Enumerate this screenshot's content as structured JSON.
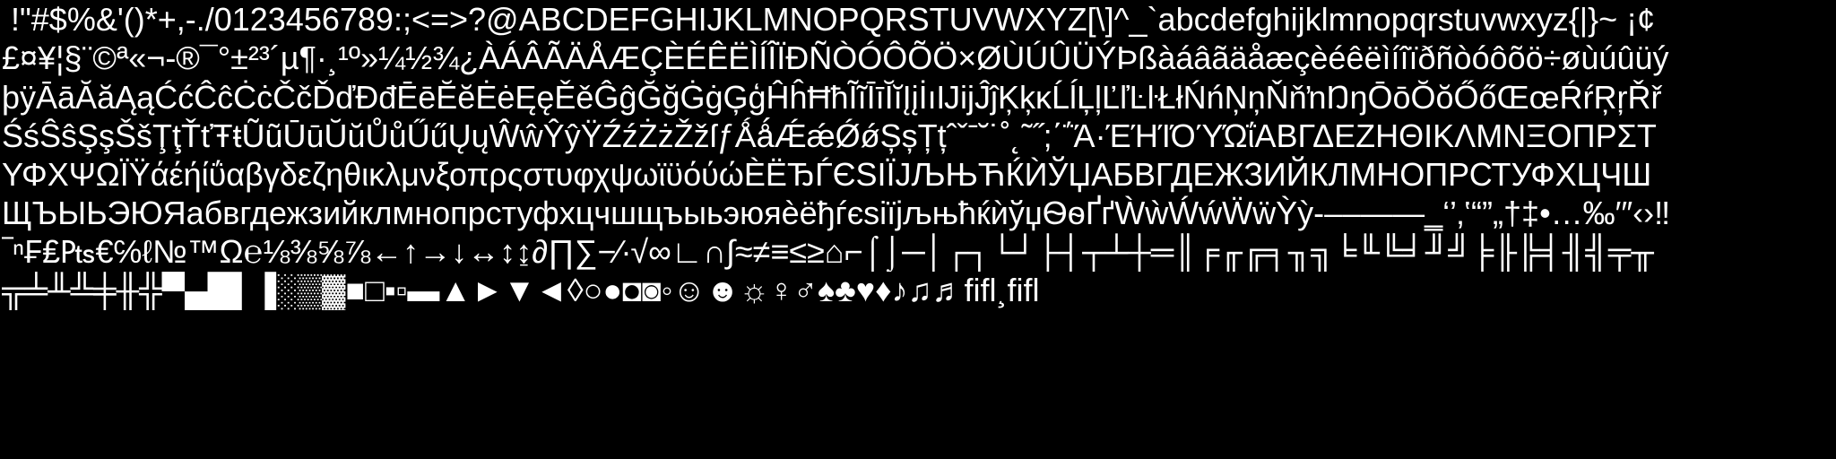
{
  "colors": {
    "background": "#000000",
    "text": "#ffffff"
  },
  "lines": [
    " !\"#$%&'()*+,-./0123456789:;<=>?@ABCDEFGHIJKLMNOPQRSTUVWXYZ[\\]^_`abcdefghijklmnopqrstuvwxyz{|}~ ¡¢",
    "£¤¥¦§¨©ª«¬-®¯°±²³´µ¶·¸¹º»¼½¾¿ÀÁÂÃÄÅÆÇÈÉÊËÌÍÎÏÐÑÒÓÔÕÖ×ØÙÚÛÜÝÞßàáâãäåæçèéêëìíîïðñòóôõö÷øùúûüý",
    "þÿĀāĂăĄąĆćĈĉĊċČčĎďĐđĒēĔĕĖėĘęĚěĜĝĞğĠġĢģĤĥĦħĨĩĪīĬĭĮįİıĲĳĴĵĶķĸĹĺĻļĽľĿŀŁłŃńŅņŇňŉŊŋŌōŎŏŐőŒœŔŕŖŗŘř",
    "ŚśŜŝŞşŠšŢţŤťŦŧŨũŪūŬŭŮůŰűŲųŴŵŶŷŸŹźŻżŽžſƒǺǻǼǽǾǿȘșȚțˆˇˉ˘˙˚˛˜˝;΄΅Ά·ΈΉΊΌΎΏΐΑΒΓΔΕΖΗΘΙΚΛΜΝΞΟΠΡΣΤ",
    "ΥΦΧΨΩΪΫάέήίΰαβγδεζηθικλμνξοπρςστυφχψωϊϋόύώЀЁЂЃЄЅІЇЈЉЊЋЌЍЎЏАБВГДЕЖЗИЙКЛМНОПРСТУФХЦЧШ",
    "ЩЪЫЬЭЮЯабвгдежзийклмнопрстуфхцчшщъыьэюяѐёђѓєѕіїјљњћќѝўџѲѳҐґẀẁẂẃẄẅỲỳ‐‒–—―‗‘’‚‛“”„†‡•…‰′″‹›‼",
    "‾ⁿ₣₤₧€℅ℓ№™Ω℮⅛⅜⅝⅞←↑→↓↔↕↨∂∏∑−∕∙√∞∟∩∫≈≠≡≤≥⌂⌐⌠⌡─│┌┐└┘├┤┬┴┼═║╒╓╔╕╖╗╘╙╚╛╜╝╞╟╠╡╢╣╤╥",
    "╦╧╨╩╪╫╬▀▄█▌▐░▒▓■□▪▫▬▲►▼◄◊○●◘◙◦☺☻☼♀♂♠♣♥♦♪♫♬ﬁﬂ¸ﬁﬂ"
  ]
}
